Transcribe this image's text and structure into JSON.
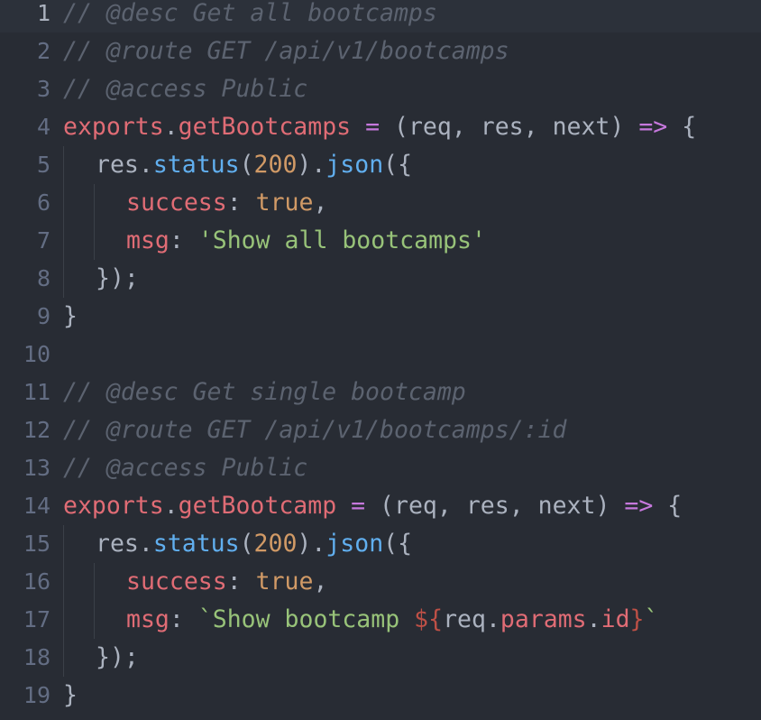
{
  "editor": {
    "lines": [
      {
        "num": "1",
        "tokens": [
          {
            "t": "// @desc Get all bootcamps",
            "c": "c-comment"
          }
        ]
      },
      {
        "num": "2",
        "tokens": [
          {
            "t": "// @route GET /api/v1/bootcamps",
            "c": "c-comment"
          }
        ]
      },
      {
        "num": "3",
        "tokens": [
          {
            "t": "// @access Public",
            "c": "c-comment"
          }
        ]
      },
      {
        "num": "4",
        "tokens": [
          {
            "t": "exports",
            "c": "c-var"
          },
          {
            "t": ".",
            "c": "c-punc"
          },
          {
            "t": "getBootcamps",
            "c": "c-var"
          },
          {
            "t": " ",
            "c": "c-punc"
          },
          {
            "t": "=",
            "c": "c-op"
          },
          {
            "t": " (",
            "c": "c-punc"
          },
          {
            "t": "req",
            "c": "c-param"
          },
          {
            "t": ", ",
            "c": "c-punc"
          },
          {
            "t": "res",
            "c": "c-param"
          },
          {
            "t": ", ",
            "c": "c-punc"
          },
          {
            "t": "next",
            "c": "c-param"
          },
          {
            "t": ") ",
            "c": "c-punc"
          },
          {
            "t": "=>",
            "c": "c-op"
          },
          {
            "t": " {",
            "c": "c-punc"
          }
        ]
      },
      {
        "num": "5",
        "indent": 1,
        "tokens": [
          {
            "t": "res",
            "c": "c-punc"
          },
          {
            "t": ".",
            "c": "c-punc"
          },
          {
            "t": "status",
            "c": "c-fn"
          },
          {
            "t": "(",
            "c": "c-punc"
          },
          {
            "t": "200",
            "c": "c-num"
          },
          {
            "t": ").",
            "c": "c-punc"
          },
          {
            "t": "json",
            "c": "c-fn"
          },
          {
            "t": "({",
            "c": "c-punc"
          }
        ]
      },
      {
        "num": "6",
        "indent": 2,
        "tokens": [
          {
            "t": "success",
            "c": "c-var"
          },
          {
            "t": ":",
            "c": "c-punc"
          },
          {
            "t": " ",
            "c": "c-punc"
          },
          {
            "t": "true",
            "c": "c-bool"
          },
          {
            "t": ",",
            "c": "c-punc"
          }
        ]
      },
      {
        "num": "7",
        "indent": 2,
        "tokens": [
          {
            "t": "msg",
            "c": "c-var"
          },
          {
            "t": ":",
            "c": "c-punc"
          },
          {
            "t": " ",
            "c": "c-punc"
          },
          {
            "t": "'Show all bootcamps'",
            "c": "c-str"
          }
        ]
      },
      {
        "num": "8",
        "indent": 1,
        "tokens": [
          {
            "t": "});",
            "c": "c-punc"
          }
        ]
      },
      {
        "num": "9",
        "tokens": [
          {
            "t": "}",
            "c": "c-punc"
          }
        ]
      },
      {
        "num": "10",
        "tokens": []
      },
      {
        "num": "11",
        "tokens": [
          {
            "t": "// @desc Get single bootcamp",
            "c": "c-comment"
          }
        ]
      },
      {
        "num": "12",
        "tokens": [
          {
            "t": "// @route GET /api/v1/bootcamps/:id",
            "c": "c-comment"
          }
        ]
      },
      {
        "num": "13",
        "tokens": [
          {
            "t": "// @access Public",
            "c": "c-comment"
          }
        ]
      },
      {
        "num": "14",
        "tokens": [
          {
            "t": "exports",
            "c": "c-var"
          },
          {
            "t": ".",
            "c": "c-punc"
          },
          {
            "t": "getBootcamp",
            "c": "c-var"
          },
          {
            "t": " ",
            "c": "c-punc"
          },
          {
            "t": "=",
            "c": "c-op"
          },
          {
            "t": " (",
            "c": "c-punc"
          },
          {
            "t": "req",
            "c": "c-param"
          },
          {
            "t": ", ",
            "c": "c-punc"
          },
          {
            "t": "res",
            "c": "c-param"
          },
          {
            "t": ", ",
            "c": "c-punc"
          },
          {
            "t": "next",
            "c": "c-param"
          },
          {
            "t": ") ",
            "c": "c-punc"
          },
          {
            "t": "=>",
            "c": "c-op"
          },
          {
            "t": " {",
            "c": "c-punc"
          }
        ]
      },
      {
        "num": "15",
        "indent": 1,
        "tokens": [
          {
            "t": "res",
            "c": "c-punc"
          },
          {
            "t": ".",
            "c": "c-punc"
          },
          {
            "t": "status",
            "c": "c-fn"
          },
          {
            "t": "(",
            "c": "c-punc"
          },
          {
            "t": "200",
            "c": "c-num"
          },
          {
            "t": ").",
            "c": "c-punc"
          },
          {
            "t": "json",
            "c": "c-fn"
          },
          {
            "t": "({",
            "c": "c-punc"
          }
        ]
      },
      {
        "num": "16",
        "indent": 2,
        "tokens": [
          {
            "t": "success",
            "c": "c-var"
          },
          {
            "t": ":",
            "c": "c-punc"
          },
          {
            "t": " ",
            "c": "c-punc"
          },
          {
            "t": "true",
            "c": "c-bool"
          },
          {
            "t": ",",
            "c": "c-punc"
          }
        ]
      },
      {
        "num": "17",
        "indent": 2,
        "tokens": [
          {
            "t": "msg",
            "c": "c-var"
          },
          {
            "t": ":",
            "c": "c-punc"
          },
          {
            "t": " ",
            "c": "c-punc"
          },
          {
            "t": "`Show bootcamp ",
            "c": "c-str"
          },
          {
            "t": "${",
            "c": "c-interp"
          },
          {
            "t": "req",
            "c": "c-punc"
          },
          {
            "t": ".",
            "c": "c-punc"
          },
          {
            "t": "params",
            "c": "c-var"
          },
          {
            "t": ".",
            "c": "c-punc"
          },
          {
            "t": "id",
            "c": "c-var"
          },
          {
            "t": "}",
            "c": "c-interp"
          },
          {
            "t": "`",
            "c": "c-str"
          }
        ]
      },
      {
        "num": "18",
        "indent": 1,
        "tokens": [
          {
            "t": "});",
            "c": "c-punc"
          }
        ]
      },
      {
        "num": "19",
        "tokens": [
          {
            "t": "}",
            "c": "c-punc"
          }
        ]
      }
    ],
    "active_line": "1",
    "colors": {
      "background": "#282c34",
      "comment": "#5c6370",
      "variable": "#e06c75",
      "function": "#61afef",
      "keyword": "#c678dd",
      "number": "#d19a66",
      "string": "#98c379",
      "text": "#abb2bf"
    }
  }
}
